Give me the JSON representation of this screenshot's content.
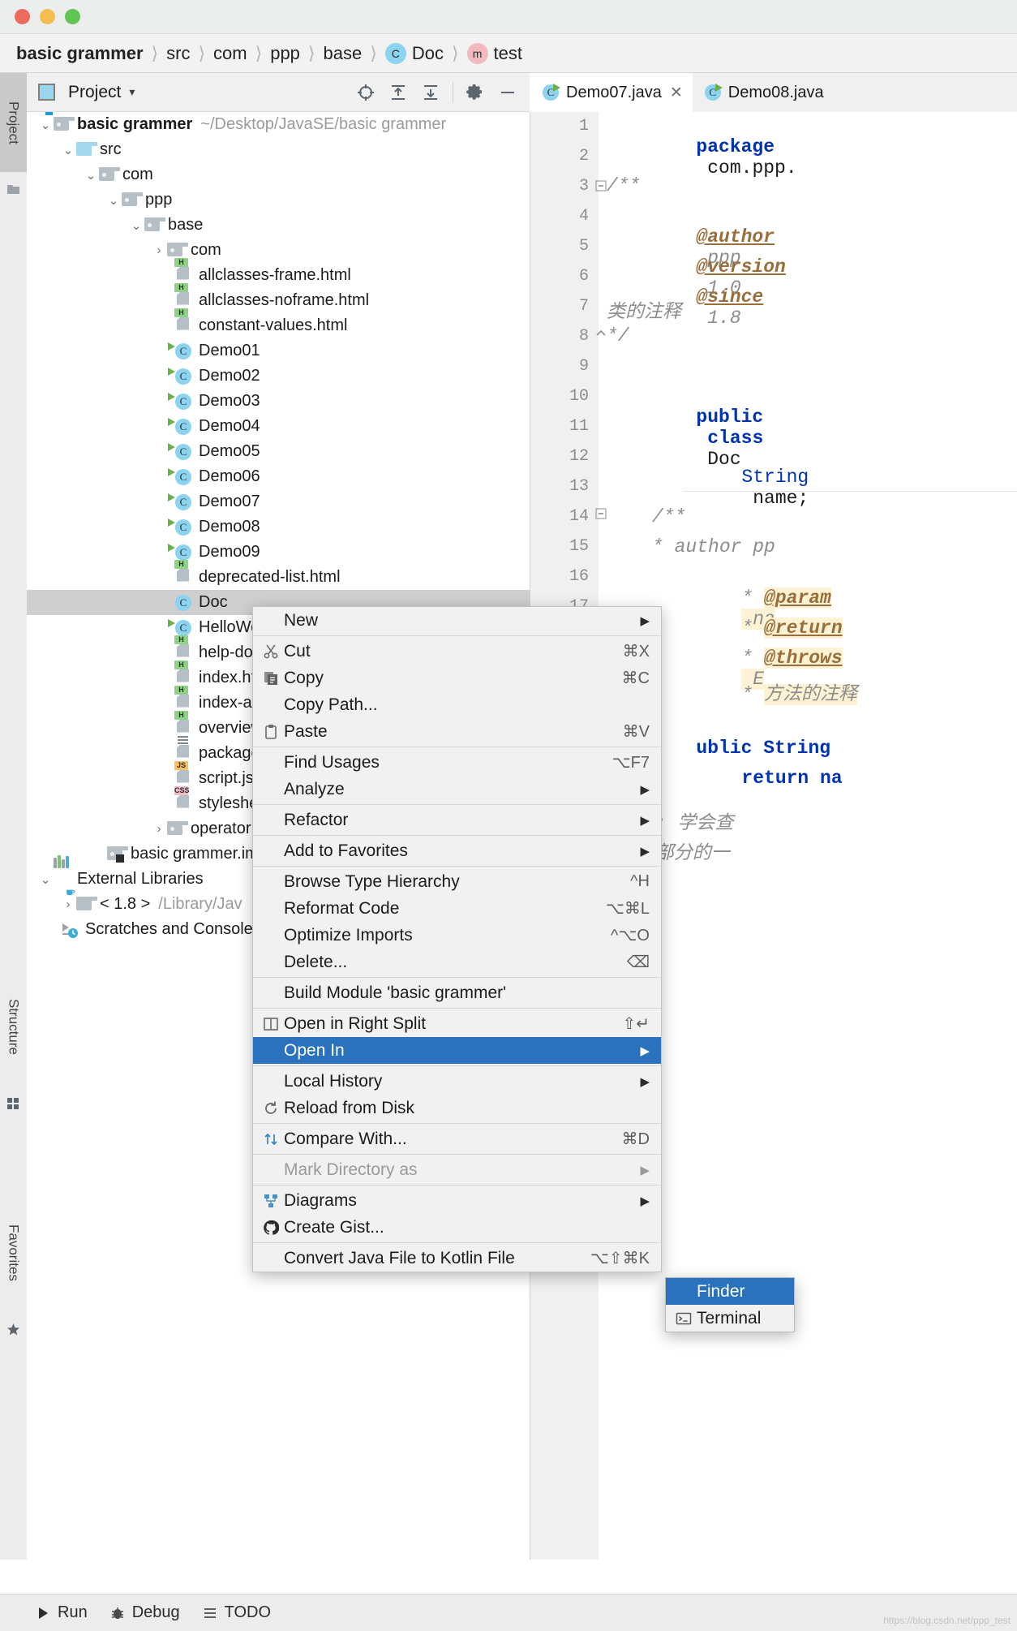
{
  "window": {
    "traffic_lights": [
      "close",
      "minimize",
      "maximize"
    ]
  },
  "breadcrumb": [
    {
      "label": "basic  grammer",
      "bold": true,
      "badge": null
    },
    {
      "label": "src",
      "bold": false,
      "badge": null
    },
    {
      "label": "com",
      "bold": false,
      "badge": null
    },
    {
      "label": "ppp",
      "bold": false,
      "badge": null
    },
    {
      "label": "base",
      "bold": false,
      "badge": null
    },
    {
      "label": "Doc",
      "bold": false,
      "badge": "C"
    },
    {
      "label": "test",
      "bold": false,
      "badge": "m"
    }
  ],
  "left_strip": {
    "project": "Project",
    "structure": "Structure",
    "favorites": "Favorites"
  },
  "tool_window": {
    "title": "Project",
    "dropdown_caret": "▾",
    "actions": [
      "locate-icon",
      "expand-all-icon",
      "collapse-all-icon",
      "settings-icon",
      "hide-icon"
    ]
  },
  "tree": {
    "items": [
      {
        "depth": 0,
        "arrow": "v",
        "icon": "module-folder",
        "label": "basic  grammer",
        "bold": true,
        "path": "~/Desktop/JavaSE/basic  grammer"
      },
      {
        "depth": 1,
        "arrow": "v",
        "icon": "source-folder",
        "label": "src"
      },
      {
        "depth": 2,
        "arrow": "v",
        "icon": "package-folder",
        "label": "com"
      },
      {
        "depth": 3,
        "arrow": "v",
        "icon": "package-folder",
        "label": "ppp"
      },
      {
        "depth": 4,
        "arrow": "v",
        "icon": "package-folder",
        "label": "base"
      },
      {
        "depth": 5,
        "arrow": ">",
        "icon": "package-folder",
        "label": "com"
      },
      {
        "depth": 5,
        "arrow": "",
        "icon": "html-file",
        "label": "allclasses-frame.html"
      },
      {
        "depth": 5,
        "arrow": "",
        "icon": "html-file",
        "label": "allclasses-noframe.html"
      },
      {
        "depth": 5,
        "arrow": "",
        "icon": "html-file",
        "label": "constant-values.html"
      },
      {
        "depth": 5,
        "arrow": "",
        "icon": "java-class-runnable",
        "label": "Demo01"
      },
      {
        "depth": 5,
        "arrow": "",
        "icon": "java-class-runnable",
        "label": "Demo02"
      },
      {
        "depth": 5,
        "arrow": "",
        "icon": "java-class-runnable",
        "label": "Demo03"
      },
      {
        "depth": 5,
        "arrow": "",
        "icon": "java-class-runnable",
        "label": "Demo04"
      },
      {
        "depth": 5,
        "arrow": "",
        "icon": "java-class-runnable",
        "label": "Demo05"
      },
      {
        "depth": 5,
        "arrow": "",
        "icon": "java-class-runnable",
        "label": "Demo06"
      },
      {
        "depth": 5,
        "arrow": "",
        "icon": "java-class-runnable",
        "label": "Demo07"
      },
      {
        "depth": 5,
        "arrow": "",
        "icon": "java-class-runnable",
        "label": "Demo08"
      },
      {
        "depth": 5,
        "arrow": "",
        "icon": "java-class-runnable",
        "label": "Demo09"
      },
      {
        "depth": 5,
        "arrow": "",
        "icon": "html-file",
        "label": "deprecated-list.html"
      },
      {
        "depth": 5,
        "arrow": "",
        "icon": "java-class",
        "label": "Doc",
        "selected": true
      },
      {
        "depth": 5,
        "arrow": "",
        "icon": "java-class-runnable",
        "label": "HelloWorld"
      },
      {
        "depth": 5,
        "arrow": "",
        "icon": "html-file",
        "label": "help-doc.html"
      },
      {
        "depth": 5,
        "arrow": "",
        "icon": "html-file",
        "label": "index.html"
      },
      {
        "depth": 5,
        "arrow": "",
        "icon": "html-file",
        "label": "index-all.html"
      },
      {
        "depth": 5,
        "arrow": "",
        "icon": "html-file",
        "label": "overview-tree.html"
      },
      {
        "depth": 5,
        "arrow": "",
        "icon": "text-file",
        "label": "package-list"
      },
      {
        "depth": 5,
        "arrow": "",
        "icon": "js-file",
        "label": "script.js"
      },
      {
        "depth": 5,
        "arrow": "",
        "icon": "css-file",
        "label": "stylesheet.css"
      },
      {
        "depth": 4,
        "arrow": ">",
        "icon": "package-folder",
        "label": "operator"
      },
      {
        "depth": 2,
        "arrow": "",
        "icon": "iml-file",
        "label": "basic  grammer.iml"
      },
      {
        "depth": 0,
        "arrow": "v",
        "icon": "external-libraries",
        "label": "External Libraries"
      },
      {
        "depth": 1,
        "arrow": ">",
        "icon": "jdk-folder",
        "label": "< 1.8 >",
        "path": "/Library/Jav"
      },
      {
        "depth": 0,
        "arrow": "",
        "icon": "scratches",
        "label": "Scratches and Consoles"
      }
    ]
  },
  "editor_tabs": [
    {
      "label": "Demo07.java",
      "icon": "java-class-runnable",
      "active": false,
      "closable": true
    },
    {
      "label": "Demo08.java",
      "icon": "java-class-runnable",
      "active": false,
      "closable": false
    }
  ],
  "editor": {
    "line_numbers": [
      "1",
      "2",
      "3",
      "4",
      "5",
      "6",
      "7",
      "8",
      "9",
      "10",
      "11",
      "12",
      "13",
      "14",
      "15",
      "16",
      "17"
    ],
    "lines": [
      {
        "n": 1,
        "text": "package com.ppp."
      },
      {
        "n": 2,
        "text": ""
      },
      {
        "n": 3,
        "text": "/**"
      },
      {
        "n": 4,
        "text": "@author ppp"
      },
      {
        "n": 5,
        "text": "@version 1.0"
      },
      {
        "n": 6,
        "text": "@since 1.8"
      },
      {
        "n": 7,
        "text": "类的注释"
      },
      {
        "n": 8,
        "text": "*/"
      },
      {
        "n": 9,
        "text": ""
      },
      {
        "n": 10,
        "text": "public class Doc"
      },
      {
        "n": 11,
        "text": ""
      },
      {
        "n": 12,
        "text": "String name;"
      },
      {
        "n": 13,
        "text": ""
      },
      {
        "n": 14,
        "text": "/**"
      },
      {
        "n": 15,
        "text": "* author pp"
      },
      {
        "n": 16,
        "text": "* @param na"
      },
      {
        "n": 17,
        "text": "* @return"
      }
    ],
    "extra_lines": [
      {
        "text": "* @throws E"
      },
      {
        "text": "* 方法的注释"
      },
      {
        "text": "*/"
      },
      {
        "text": "ublic String"
      },
      {
        "text": "return na"
      },
      {
        "text": "/作业: 学会查"
      },
      {
        "text": "/基础部分的一"
      }
    ],
    "tokens": {
      "package": "package",
      "import_path": "com.ppp.",
      "author_tag": "@author",
      "author_value": "ppp",
      "version_tag": "@version",
      "version_value": "1.0",
      "since_tag": "@since",
      "since_value": "1.8",
      "class_comment": "类的注释",
      "public": "public",
      "class": "class",
      "class_name": "Doc",
      "string_type": "String",
      "field_name": "name;",
      "param_tag": "@param",
      "return_tag": "@return",
      "throws_tag": "@throws",
      "method_comment": "方法的注释"
    }
  },
  "context_menu": {
    "items": [
      {
        "label": "New",
        "icon": null,
        "shortcut": "",
        "submenu": true,
        "sep_after": true
      },
      {
        "label": "Cut",
        "icon": "scissors-icon",
        "shortcut": "⌘X",
        "submenu": false
      },
      {
        "label": "Copy",
        "icon": "copy-icon",
        "shortcut": "⌘C",
        "submenu": false
      },
      {
        "label": "Copy Path...",
        "icon": null,
        "shortcut": "",
        "submenu": false
      },
      {
        "label": "Paste",
        "icon": "clipboard-icon",
        "shortcut": "⌘V",
        "submenu": false,
        "sep_after": true
      },
      {
        "label": "Find Usages",
        "icon": null,
        "shortcut": "⌥F7",
        "submenu": false
      },
      {
        "label": "Analyze",
        "icon": null,
        "shortcut": "",
        "submenu": true,
        "sep_after": true
      },
      {
        "label": "Refactor",
        "icon": null,
        "shortcut": "",
        "submenu": true,
        "sep_after": true
      },
      {
        "label": "Add to Favorites",
        "icon": null,
        "shortcut": "",
        "submenu": true,
        "sep_after": true
      },
      {
        "label": "Browse Type Hierarchy",
        "icon": null,
        "shortcut": "^H",
        "submenu": false
      },
      {
        "label": "Reformat Code",
        "icon": null,
        "shortcut": "⌥⌘L",
        "submenu": false
      },
      {
        "label": "Optimize Imports",
        "icon": null,
        "shortcut": "^⌥O",
        "submenu": false
      },
      {
        "label": "Delete...",
        "icon": null,
        "shortcut": "⌫",
        "submenu": false,
        "sep_after": true
      },
      {
        "label": "Build Module 'basic  grammer'",
        "icon": null,
        "shortcut": "",
        "submenu": false,
        "sep_after": true
      },
      {
        "label": "Open in Right Split",
        "icon": "split-icon",
        "shortcut": "⇧↵",
        "submenu": false
      },
      {
        "label": "Open In",
        "icon": null,
        "shortcut": "",
        "submenu": true,
        "highlighted": true,
        "sep_after": true
      },
      {
        "label": "Local History",
        "icon": null,
        "shortcut": "",
        "submenu": true
      },
      {
        "label": "Reload from Disk",
        "icon": "refresh-icon",
        "shortcut": "",
        "submenu": false,
        "sep_after": true
      },
      {
        "label": "Compare With...",
        "icon": "compare-icon",
        "shortcut": "⌘D",
        "submenu": false,
        "sep_after": true
      },
      {
        "label": "Mark Directory as",
        "icon": null,
        "shortcut": "",
        "submenu": true,
        "disabled": true,
        "sep_after": true
      },
      {
        "label": "Diagrams",
        "icon": "diagram-icon",
        "shortcut": "",
        "submenu": true
      },
      {
        "label": "Create Gist...",
        "icon": "github-icon",
        "shortcut": "",
        "submenu": false,
        "sep_after": true
      },
      {
        "label": "Convert Java File to Kotlin File",
        "icon": null,
        "shortcut": "⌥⇧⌘K",
        "submenu": false
      }
    ]
  },
  "submenu": {
    "items": [
      {
        "label": "Finder",
        "icon": null,
        "highlighted": true
      },
      {
        "label": "Terminal",
        "icon": "terminal-icon",
        "highlighted": false
      }
    ]
  },
  "status_bar": {
    "items": [
      {
        "label": "Run",
        "icon": "run-icon"
      },
      {
        "label": "Debug",
        "icon": "debug-icon"
      },
      {
        "label": "TODO",
        "icon": "todo-icon"
      }
    ]
  },
  "watermark": "https://blog.csdn.net/ppp_test",
  "colors": {
    "accent": "#2a72bd",
    "selection": "#cfcfcf",
    "class_badge": "#8cd3ef",
    "method_badge": "#f3b9c0",
    "html_badge": "#8fd185",
    "js_badge": "#f7c163",
    "css_badge": "#f6b8c6",
    "keyword": "#0033b3",
    "javadoc": "#8c8c8c"
  }
}
